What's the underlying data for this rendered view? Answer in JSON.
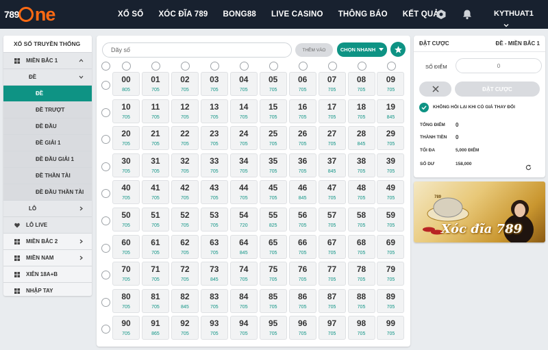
{
  "header": {
    "logo": {
      "number": "789",
      "brand": "ne"
    },
    "nav": [
      "XỔ SỐ",
      "XÓC ĐĨA 789",
      "BONG88",
      "LIVE CASINO",
      "THÔNG BÁO",
      "KẾT QUẢ"
    ],
    "username": "KYTHUAT1",
    "icons": [
      "gear-icon",
      "bell-icon",
      "chevron-down-icon"
    ]
  },
  "sidebar": {
    "title": "XỔ SỐ TRUYỀN THỐNG",
    "items": [
      {
        "label": "MIỀN BẮC 1",
        "icon": "grid-icon",
        "chevron": "up"
      },
      {
        "label": "ĐỀ",
        "chevron": "down"
      },
      {
        "label": "ĐỀ",
        "active": true
      },
      {
        "label": "ĐỀ TRƯỢT"
      },
      {
        "label": "ĐỀ ĐẦU"
      },
      {
        "label": "ĐỀ GIẢI 1"
      },
      {
        "label": "ĐỀ ĐẦU GIẢI 1"
      },
      {
        "label": "ĐỀ THẦN TÀI"
      },
      {
        "label": "ĐỀ ĐẦU THẦN TÀI"
      },
      {
        "label": "LÔ",
        "chevron": "right"
      },
      {
        "label": "LÔ LIVE",
        "icon": "heart-icon"
      },
      {
        "label": "MIỀN BẮC 2",
        "icon": "grid-icon",
        "chevron": "right"
      },
      {
        "label": "MIỀN NAM",
        "icon": "grid-icon",
        "chevron": "right"
      },
      {
        "label": "XIÊN 18A+B",
        "icon": "grid-icon"
      },
      {
        "label": "NHẬP TAY",
        "icon": "grid-icon"
      }
    ]
  },
  "main": {
    "search_placeholder": "Dãy số",
    "add_button": "THÊM VÀO",
    "quick_button": "CHỌN NHANH",
    "numbers": [
      {
        "n": "00",
        "p": "805"
      },
      {
        "n": "01",
        "p": "705"
      },
      {
        "n": "02",
        "p": "705"
      },
      {
        "n": "03",
        "p": "705"
      },
      {
        "n": "04",
        "p": "705"
      },
      {
        "n": "05",
        "p": "705"
      },
      {
        "n": "06",
        "p": "705"
      },
      {
        "n": "07",
        "p": "705"
      },
      {
        "n": "08",
        "p": "705"
      },
      {
        "n": "09",
        "p": "705"
      },
      {
        "n": "10",
        "p": "705"
      },
      {
        "n": "11",
        "p": "705"
      },
      {
        "n": "12",
        "p": "705"
      },
      {
        "n": "13",
        "p": "705"
      },
      {
        "n": "14",
        "p": "705"
      },
      {
        "n": "15",
        "p": "705"
      },
      {
        "n": "16",
        "p": "705"
      },
      {
        "n": "17",
        "p": "705"
      },
      {
        "n": "18",
        "p": "705"
      },
      {
        "n": "19",
        "p": "845"
      },
      {
        "n": "20",
        "p": "705"
      },
      {
        "n": "21",
        "p": "705"
      },
      {
        "n": "22",
        "p": "705"
      },
      {
        "n": "23",
        "p": "705"
      },
      {
        "n": "24",
        "p": "705"
      },
      {
        "n": "25",
        "p": "705"
      },
      {
        "n": "26",
        "p": "705"
      },
      {
        "n": "27",
        "p": "705"
      },
      {
        "n": "28",
        "p": "845"
      },
      {
        "n": "29",
        "p": "705"
      },
      {
        "n": "30",
        "p": "705"
      },
      {
        "n": "31",
        "p": "705"
      },
      {
        "n": "32",
        "p": "705"
      },
      {
        "n": "33",
        "p": "705"
      },
      {
        "n": "34",
        "p": "705"
      },
      {
        "n": "35",
        "p": "705"
      },
      {
        "n": "36",
        "p": "705"
      },
      {
        "n": "37",
        "p": "845"
      },
      {
        "n": "38",
        "p": "705"
      },
      {
        "n": "39",
        "p": "705"
      },
      {
        "n": "40",
        "p": "705"
      },
      {
        "n": "41",
        "p": "705"
      },
      {
        "n": "42",
        "p": "705"
      },
      {
        "n": "43",
        "p": "705"
      },
      {
        "n": "44",
        "p": "705"
      },
      {
        "n": "45",
        "p": "705"
      },
      {
        "n": "46",
        "p": "845"
      },
      {
        "n": "47",
        "p": "705"
      },
      {
        "n": "48",
        "p": "705"
      },
      {
        "n": "49",
        "p": "705"
      },
      {
        "n": "50",
        "p": "705"
      },
      {
        "n": "51",
        "p": "705"
      },
      {
        "n": "52",
        "p": "705"
      },
      {
        "n": "53",
        "p": "705"
      },
      {
        "n": "54",
        "p": "720"
      },
      {
        "n": "55",
        "p": "825"
      },
      {
        "n": "56",
        "p": "705"
      },
      {
        "n": "57",
        "p": "705"
      },
      {
        "n": "58",
        "p": "705"
      },
      {
        "n": "59",
        "p": "705"
      },
      {
        "n": "60",
        "p": "705"
      },
      {
        "n": "61",
        "p": "705"
      },
      {
        "n": "62",
        "p": "705"
      },
      {
        "n": "63",
        "p": "705"
      },
      {
        "n": "64",
        "p": "845"
      },
      {
        "n": "65",
        "p": "705"
      },
      {
        "n": "66",
        "p": "705"
      },
      {
        "n": "67",
        "p": "705"
      },
      {
        "n": "68",
        "p": "705"
      },
      {
        "n": "69",
        "p": "705"
      },
      {
        "n": "70",
        "p": "705"
      },
      {
        "n": "71",
        "p": "705"
      },
      {
        "n": "72",
        "p": "705"
      },
      {
        "n": "73",
        "p": "845"
      },
      {
        "n": "74",
        "p": "705"
      },
      {
        "n": "75",
        "p": "705"
      },
      {
        "n": "76",
        "p": "705"
      },
      {
        "n": "77",
        "p": "705"
      },
      {
        "n": "78",
        "p": "705"
      },
      {
        "n": "79",
        "p": "705"
      },
      {
        "n": "80",
        "p": "705"
      },
      {
        "n": "81",
        "p": "705"
      },
      {
        "n": "82",
        "p": "845"
      },
      {
        "n": "83",
        "p": "705"
      },
      {
        "n": "84",
        "p": "705"
      },
      {
        "n": "85",
        "p": "705"
      },
      {
        "n": "86",
        "p": "705"
      },
      {
        "n": "87",
        "p": "705"
      },
      {
        "n": "88",
        "p": "705"
      },
      {
        "n": "89",
        "p": "705"
      },
      {
        "n": "90",
        "p": "705"
      },
      {
        "n": "91",
        "p": "865"
      },
      {
        "n": "92",
        "p": "705"
      },
      {
        "n": "93",
        "p": "705"
      },
      {
        "n": "94",
        "p": "705"
      },
      {
        "n": "95",
        "p": "705"
      },
      {
        "n": "96",
        "p": "705"
      },
      {
        "n": "97",
        "p": "705"
      },
      {
        "n": "98",
        "p": "705"
      },
      {
        "n": "99",
        "p": "705"
      }
    ]
  },
  "bet": {
    "title": "ĐẶT CƯỢC",
    "subtitle": "ĐỀ - MIỀN BẮC 1",
    "points_label": "SỐ ĐIỂM",
    "points_value": "0",
    "bet_button": "ĐẶT CƯỢC",
    "confirm_label": "KHÔNG HỎI LẠI KHI CÓ GIÁ THAY ĐỔI",
    "total_points_label": "TỔNG ĐIỂM",
    "total_points": "0",
    "amount_label": "THÀNH TIỀN",
    "amount": "0",
    "max_label": "TỐI ĐA",
    "max_value": "5,000 ĐIỂM",
    "balance_label": "SỐ DƯ",
    "balance": "158,000"
  },
  "banner": {
    "text": "Xóc đĩa 789",
    "badge": "789"
  },
  "colors": {
    "accent": "#0e9384",
    "topbar": "#18212f",
    "logo": "#ff6a13",
    "background": "#e9ecef"
  }
}
